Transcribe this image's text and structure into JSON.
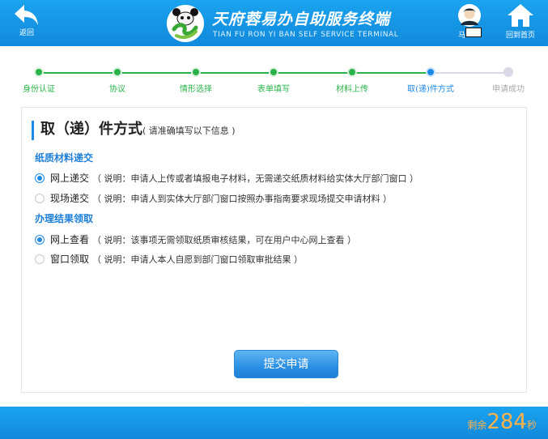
{
  "header": {
    "back_label": "返回",
    "title": "天府蓉易办自助服务终端",
    "subtitle": "TIAN FU RON YI BAN SELF SERVICE TERMINAL",
    "user_name": "马",
    "home_label": "回到首页"
  },
  "steps": [
    {
      "label": "身份认证",
      "state": "done"
    },
    {
      "label": "协议",
      "state": "done"
    },
    {
      "label": "情形选择",
      "state": "done"
    },
    {
      "label": "表单填写",
      "state": "done"
    },
    {
      "label": "材料上传",
      "state": "done"
    },
    {
      "label": "取(递)件方式",
      "state": "current"
    },
    {
      "label": "申请成功",
      "state": "todo"
    }
  ],
  "main": {
    "title": "取（递）件方式",
    "title_hint": "( 请准确填写以下信息 )",
    "section1": {
      "title": "纸质材料递交",
      "options": [
        {
          "label": "网上递交",
          "desc": "（ 说明：申请人上传或者填报电子材料，无需递交纸质材料给实体大厅部门窗口 ）",
          "checked": true
        },
        {
          "label": "现场递交",
          "desc": "（ 说明：申请人到实体大厅部门窗口按照办事指南要求现场提交申请材料 ）",
          "checked": false
        }
      ]
    },
    "section2": {
      "title": "办理结果领取",
      "options": [
        {
          "label": "网上查看",
          "desc": "（ 说明：该事项无需领取纸质审核结果，可在用户中心网上查看 ）",
          "checked": true
        },
        {
          "label": "窗口领取",
          "desc": "（ 说明：申请人本人自愿到部门窗口领取审批结果 ）",
          "checked": false
        }
      ]
    },
    "submit_label": "提交申请"
  },
  "footer": {
    "countdown_prefix": "剩余",
    "countdown_value": "284",
    "countdown_suffix": "秒"
  },
  "colors": {
    "header_blue": "#1289dc",
    "done_green": "#2ab34a",
    "current_blue": "#1e88e5",
    "countdown_orange": "#ffb24a"
  },
  "icons": {
    "back": "back-arrow-icon",
    "logo": "panda-logo-icon",
    "user": "user-avatar-icon",
    "home": "home-icon"
  }
}
